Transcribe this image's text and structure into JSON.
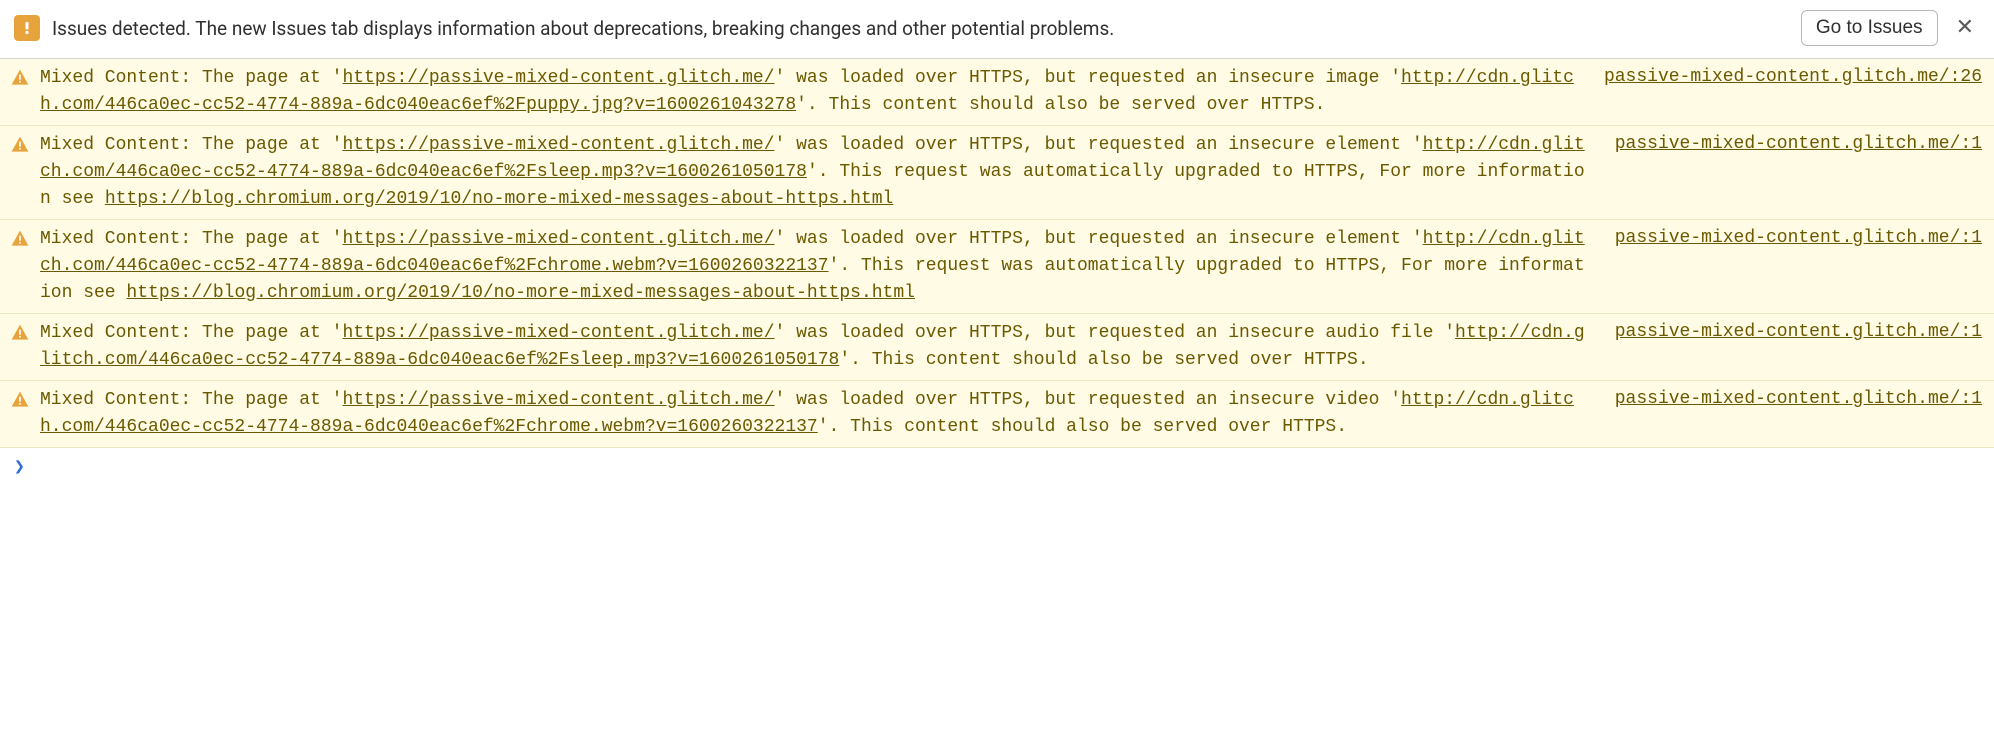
{
  "issues_bar": {
    "text": "Issues detected. The new Issues tab displays information about deprecations, breaking changes and other potential problems.",
    "button_label": "Go to Issues",
    "close_glyph": "✕"
  },
  "warnings": [
    {
      "pre1": "Mixed Content: The page at '",
      "page_url": "https://passive-mixed-content.glitch.me/",
      "mid1": "' was loaded over HTTPS, but requested an insecure image '",
      "resource_url": "http://cdn.glitch.com/446ca0ec-cc52-4774-889a-6dc040eac6ef%2Fpuppy.jpg?v=1600261043278",
      "tail": "'. This content should also be served over HTTPS.",
      "info_url": "",
      "source": "passive-mixed-content.glitch.me/:26"
    },
    {
      "pre1": "Mixed Content: The page at '",
      "page_url": "https://passive-mixed-content.glitch.me/",
      "mid1": "' was loaded over HTTPS, but requested an insecure element '",
      "resource_url": "http://cdn.glitch.com/446ca0ec-cc52-4774-889a-6dc040eac6ef%2Fsleep.mp3?v=1600261050178",
      "tail": "'. This request was automatically upgraded to HTTPS, For more information see ",
      "info_url": "https://blog.chromium.org/2019/10/no-more-mixed-messages-about-https.html",
      "source": "passive-mixed-content.glitch.me/:1"
    },
    {
      "pre1": "Mixed Content: The page at '",
      "page_url": "https://passive-mixed-content.glitch.me/",
      "mid1": "' was loaded over HTTPS, but requested an insecure element '",
      "resource_url": "http://cdn.glitch.com/446ca0ec-cc52-4774-889a-6dc040eac6ef%2Fchrome.webm?v=1600260322137",
      "tail": "'. This request was automatically upgraded to HTTPS, For more information see ",
      "info_url": "https://blog.chromium.org/2019/10/no-more-mixed-messages-about-https.html",
      "source": "passive-mixed-content.glitch.me/:1"
    },
    {
      "pre1": "Mixed Content: The page at '",
      "page_url": "https://passive-mixed-content.glitch.me/",
      "mid1": "' was loaded over HTTPS, but requested an insecure audio file '",
      "resource_url": "http://cdn.glitch.com/446ca0ec-cc52-4774-889a-6dc040eac6ef%2Fsleep.mp3?v=1600261050178",
      "tail": "'. This content should also be served over HTTPS.",
      "info_url": "",
      "source": "passive-mixed-content.glitch.me/:1"
    },
    {
      "pre1": "Mixed Content: The page at '",
      "page_url": "https://passive-mixed-content.glitch.me/",
      "mid1": "' was loaded over HTTPS, but requested an insecure video '",
      "resource_url": "http://cdn.glitch.com/446ca0ec-cc52-4774-889a-6dc040eac6ef%2Fchrome.webm?v=1600260322137",
      "tail": "'. This content should also be served over HTTPS.",
      "info_url": "",
      "source": "passive-mixed-content.glitch.me/:1"
    }
  ],
  "prompt": {
    "chevron": "❯"
  }
}
